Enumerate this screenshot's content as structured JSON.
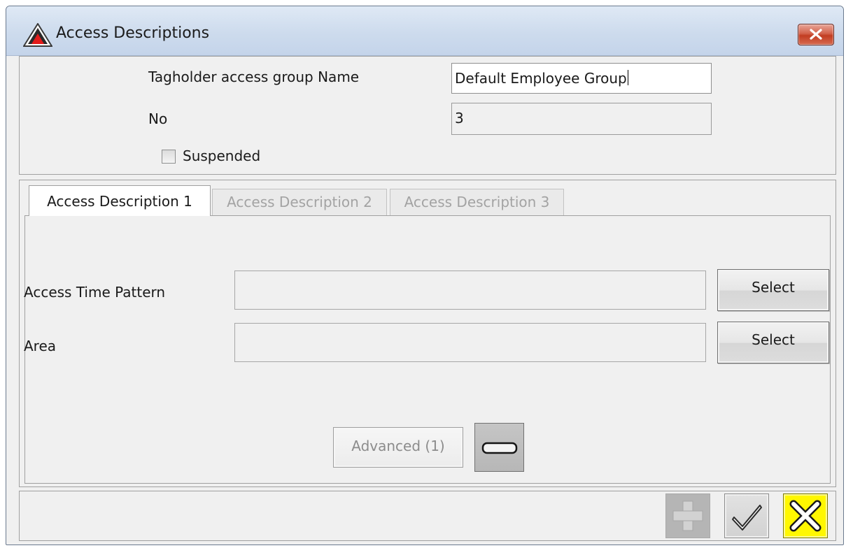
{
  "window": {
    "title": "Access Descriptions",
    "icon": "warning-triangle-icon",
    "close_icon": "close-icon"
  },
  "header": {
    "name_label": "Tagholder access group Name",
    "name_value": "Default Employee Group",
    "no_label": "No",
    "no_value": "3",
    "suspended_label": "Suspended",
    "suspended_checked": false
  },
  "tabs": [
    {
      "label": "Access Description 1",
      "active": true,
      "enabled": true
    },
    {
      "label": "Access Description 2",
      "active": false,
      "enabled": false
    },
    {
      "label": "Access Description 3",
      "active": false,
      "enabled": false
    }
  ],
  "access": {
    "time_pattern_label": "Access Time Pattern",
    "time_pattern_value": "",
    "area_label": "Area",
    "area_value": "",
    "select_label": "Select",
    "advanced_label": "Advanced (1)",
    "minus_icon": "minus-icon"
  },
  "footer": {
    "add_icon": "plus-icon",
    "ok_icon": "checkmark-icon",
    "cancel_icon": "x-icon"
  },
  "colors": {
    "cancel_button": "#fff700",
    "title_gradient_top": "#dfe9f5",
    "close_button": "#c23d22"
  }
}
